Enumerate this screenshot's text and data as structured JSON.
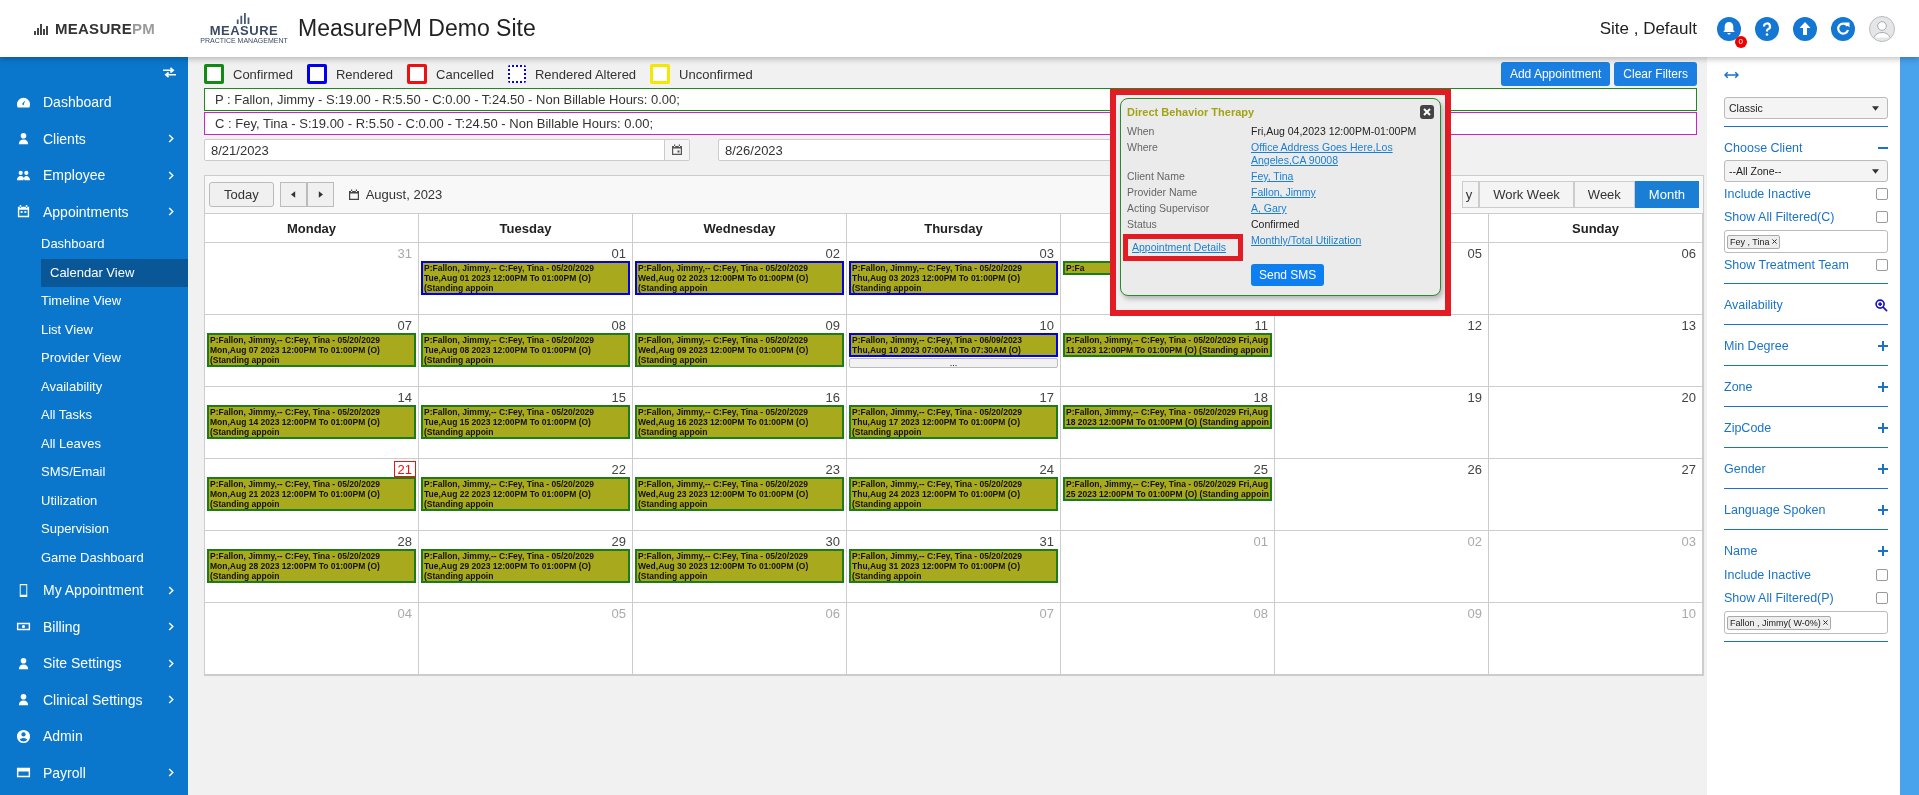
{
  "logo": {
    "main": "MEASURE",
    "accent": "PM"
  },
  "brand": {
    "main": "MEASURE",
    "tagline": "PRACTICE MANAGEMENT"
  },
  "site_title": "MeasurePM Demo Site",
  "user": {
    "site": "Site , Default",
    "notifications": "0"
  },
  "sidebar": {
    "items": [
      {
        "label": "Dashboard",
        "has_submenu": false
      },
      {
        "label": "Clients",
        "has_submenu": true
      },
      {
        "label": "Employee",
        "has_submenu": true
      },
      {
        "label": "Appointments",
        "has_submenu": true,
        "children": [
          {
            "label": "Dashboard",
            "selected": false
          },
          {
            "label": "Calendar View",
            "selected": true
          },
          {
            "label": "Timeline View",
            "selected": false
          },
          {
            "label": "List View",
            "selected": false
          },
          {
            "label": "Provider View",
            "selected": false
          },
          {
            "label": "Availability",
            "selected": false
          },
          {
            "label": "All Tasks",
            "selected": false
          },
          {
            "label": "All Leaves",
            "selected": false
          },
          {
            "label": "SMS/Email",
            "selected": false
          },
          {
            "label": "Utilization",
            "selected": false
          },
          {
            "label": "Supervision",
            "selected": false
          },
          {
            "label": "Game Dashboard",
            "selected": false
          }
        ]
      },
      {
        "label": "My Appointment",
        "has_submenu": true
      },
      {
        "label": "Billing",
        "has_submenu": true
      },
      {
        "label": "Site Settings",
        "has_submenu": true
      },
      {
        "label": "Clinical Settings",
        "has_submenu": true
      },
      {
        "label": "Admin",
        "has_submenu": false
      },
      {
        "label": "Payroll",
        "has_submenu": true
      }
    ]
  },
  "legend": [
    {
      "label": "Confirmed",
      "color": "#138a13",
      "dashed": false
    },
    {
      "label": "Rendered",
      "color": "#0000ee",
      "dashed": false
    },
    {
      "label": "Cancelled",
      "color": "#ee1111",
      "dashed": false
    },
    {
      "label": "Rendered Altered",
      "color": "#0000ee",
      "dashed": true
    },
    {
      "label": "Unconfirmed",
      "color": "#f5e800",
      "dashed": false
    }
  ],
  "actions": [
    "Add Appointment",
    "Clear Filters"
  ],
  "summaries": [
    {
      "text": "P : Fallon, Jimmy - S:19.00 - R:5.50 - C:0.00 - T:24.50 - Non Billable Hours: 0.00;",
      "color": "#1e8a1e"
    },
    {
      "text": "C : Fey, Tina - S:19.00 - R:5.50 - C:0.00 - T:24.50 - Non Billable Hours: 0.00;",
      "color": "#cc22cc"
    }
  ],
  "date_range": {
    "start": "8/21/2023",
    "end": "8/26/2023"
  },
  "calendar": {
    "today_button": "Today",
    "period": "August, 2023",
    "views": [
      {
        "label": "y",
        "selected": false
      },
      {
        "label": "Work Week",
        "selected": false
      },
      {
        "label": "Week",
        "selected": false
      },
      {
        "label": "Month",
        "selected": true
      }
    ],
    "day_headers": [
      "Monday",
      "Tuesday",
      "Wednesday",
      "Thursday",
      "Sunday"
    ],
    "weeks": [
      {
        "days": [
          {
            "day": "31",
            "muted": true,
            "today": false
          },
          {
            "day": "01",
            "muted": false,
            "today": false,
            "events": [
              {
                "color": "#0000ee",
                "text": "P:Fallon, Jimmy,-- C:Fey, Tina - 05/20/2029 Tue,Aug 01 2023 12:00PM To 01:00PM (O) (Standing appoin"
              }
            ]
          },
          {
            "day": "02",
            "muted": false,
            "today": false,
            "events": [
              {
                "color": "#0000ee",
                "text": "P:Fallon, Jimmy,-- C:Fey, Tina - 05/20/2029 Wed,Aug 02 2023 12:00PM To 01:00PM (O) (Standing appoin"
              }
            ]
          },
          {
            "day": "03",
            "muted": false,
            "today": false,
            "events": [
              {
                "color": "#0000ee",
                "text": "P:Fallon, Jimmy,-- C:Fey, Tina - 05/20/2029 Thu,Aug 03 2023 12:00PM To 01:00PM (O) (Standing appoin"
              }
            ]
          },
          {
            "events": [
              {
                "color": "#1a7d1a",
                "text": "P:Fa"
              }
            ]
          },
          {
            "day": "05",
            "muted": false,
            "today": false
          },
          {
            "day": "06",
            "muted": false,
            "today": false
          }
        ]
      },
      {
        "days": [
          {
            "day": "07",
            "muted": false,
            "today": false,
            "events": [
              {
                "color": "#1a7d1a",
                "text": "P:Fallon, Jimmy,-- C:Fey, Tina - 05/20/2029 Mon,Aug 07 2023 12:00PM To 01:00PM (O) (Standing appoin"
              }
            ]
          },
          {
            "day": "08",
            "muted": false,
            "today": false,
            "events": [
              {
                "color": "#1a7d1a",
                "text": "P:Fallon, Jimmy,-- C:Fey, Tina - 05/20/2029 Tue,Aug 08 2023 12:00PM To 01:00PM (O) (Standing appoin"
              }
            ]
          },
          {
            "day": "09",
            "muted": false,
            "today": false,
            "events": [
              {
                "color": "#1a7d1a",
                "text": "P:Fallon, Jimmy,-- C:Fey, Tina - 05/20/2029 Wed,Aug 09 2023 12:00PM To 01:00PM (O) (Standing appoin"
              }
            ]
          },
          {
            "day": "10",
            "muted": false,
            "today": false,
            "events": [
              {
                "color": "#0000ee",
                "text": "P:Fallon, Jimmy,-- C:Fey, Tina - 06/09/2023 Thu,Aug 10 2023 07:00AM To 07:30AM (O)"
              }
            ],
            "more": "..."
          },
          {
            "day": "11",
            "muted": false,
            "today": false,
            "events": [
              {
                "color": "#1a7d1a",
                "text": "P:Fallon, Jimmy,-- C:Fey, Tina - 05/20/2029 Fri,Aug 11 2023 12:00PM To 01:00PM (O) (Standing appoin"
              }
            ]
          },
          {
            "day": "12",
            "muted": false,
            "today": false
          },
          {
            "day": "13",
            "muted": false,
            "today": false
          }
        ]
      },
      {
        "days": [
          {
            "day": "14",
            "muted": false,
            "today": false,
            "events": [
              {
                "color": "#1a7d1a",
                "text": "P:Fallon, Jimmy,-- C:Fey, Tina - 05/20/2029 Mon,Aug 14 2023 12:00PM To 01:00PM (O) (Standing appoin"
              }
            ]
          },
          {
            "day": "15",
            "muted": false,
            "today": false,
            "events": [
              {
                "color": "#1a7d1a",
                "text": "P:Fallon, Jimmy,-- C:Fey, Tina - 05/20/2029 Tue,Aug 15 2023 12:00PM To 01:00PM (O) (Standing appoin"
              }
            ]
          },
          {
            "day": "16",
            "muted": false,
            "today": false,
            "events": [
              {
                "color": "#1a7d1a",
                "text": "P:Fallon, Jimmy,-- C:Fey, Tina - 05/20/2029 Wed,Aug 16 2023 12:00PM To 01:00PM (O) (Standing appoin"
              }
            ]
          },
          {
            "day": "17",
            "muted": false,
            "today": false,
            "events": [
              {
                "color": "#1a7d1a",
                "text": "P:Fallon, Jimmy,-- C:Fey, Tina - 05/20/2029 Thu,Aug 17 2023 12:00PM To 01:00PM (O) (Standing appoin"
              }
            ]
          },
          {
            "day": "18",
            "muted": false,
            "today": false,
            "events": [
              {
                "color": "#1a7d1a",
                "text": "P:Fallon, Jimmy,-- C:Fey, Tina - 05/20/2029 Fri,Aug 18 2023 12:00PM To 01:00PM (O) (Standing appoin"
              }
            ]
          },
          {
            "day": "19",
            "muted": false,
            "today": false
          },
          {
            "day": "20",
            "muted": false,
            "today": false
          }
        ]
      },
      {
        "days": [
          {
            "day": "21",
            "muted": false,
            "today": true,
            "events": [
              {
                "color": "#1a7d1a",
                "text": "P:Fallon, Jimmy,-- C:Fey, Tina - 05/20/2029 Mon,Aug 21 2023 12:00PM To 01:00PM (O) (Standing appoin"
              }
            ]
          },
          {
            "day": "22",
            "muted": false,
            "today": false,
            "events": [
              {
                "color": "#1a7d1a",
                "text": "P:Fallon, Jimmy,-- C:Fey, Tina - 05/20/2029 Tue,Aug 22 2023 12:00PM To 01:00PM (O) (Standing appoin"
              }
            ]
          },
          {
            "day": "23",
            "muted": false,
            "today": false,
            "events": [
              {
                "color": "#1a7d1a",
                "text": "P:Fallon, Jimmy,-- C:Fey, Tina - 05/20/2029 Wed,Aug 23 2023 12:00PM To 01:00PM (O) (Standing appoin"
              }
            ]
          },
          {
            "day": "24",
            "muted": false,
            "today": false,
            "events": [
              {
                "color": "#1a7d1a",
                "text": "P:Fallon, Jimmy,-- C:Fey, Tina - 05/20/2029 Thu,Aug 24 2023 12:00PM To 01:00PM (O) (Standing appoin"
              }
            ]
          },
          {
            "day": "25",
            "muted": false,
            "today": false,
            "events": [
              {
                "color": "#1a7d1a",
                "text": "P:Fallon, Jimmy,-- C:Fey, Tina - 05/20/2029 Fri,Aug 25 2023 12:00PM To 01:00PM (O) (Standing appoin"
              }
            ]
          },
          {
            "day": "26",
            "muted": false,
            "today": false
          },
          {
            "day": "27",
            "muted": false,
            "today": false
          }
        ]
      },
      {
        "days": [
          {
            "day": "28",
            "muted": false,
            "today": false,
            "events": [
              {
                "color": "#1a7d1a",
                "text": "P:Fallon, Jimmy,-- C:Fey, Tina - 05/20/2029 Mon,Aug 28 2023 12:00PM To 01:00PM (O) (Standing appoin"
              }
            ]
          },
          {
            "day": "29",
            "muted": false,
            "today": false,
            "events": [
              {
                "color": "#1a7d1a",
                "text": "P:Fallon, Jimmy,-- C:Fey, Tina - 05/20/2029 Tue,Aug 29 2023 12:00PM To 01:00PM (O) (Standing appoin"
              }
            ]
          },
          {
            "day": "30",
            "muted": false,
            "today": false,
            "events": [
              {
                "color": "#1a7d1a",
                "text": "P:Fallon, Jimmy,-- C:Fey, Tina - 05/20/2029 Wed,Aug 30 2023 12:00PM To 01:00PM (O) (Standing appoin"
              }
            ]
          },
          {
            "day": "31",
            "muted": false,
            "today": false,
            "events": [
              {
                "color": "#1a7d1a",
                "text": "P:Fallon, Jimmy,-- C:Fey, Tina - 05/20/2029 Thu,Aug 31 2023 12:00PM To 01:00PM (O) (Standing appoin"
              }
            ]
          },
          {
            "day": "01",
            "muted": true,
            "today": false
          },
          {
            "day": "02",
            "muted": true,
            "today": false
          },
          {
            "day": "03",
            "muted": true,
            "today": false
          }
        ]
      },
      {
        "days": [
          {
            "day": "04",
            "muted": true,
            "today": false
          },
          {
            "day": "05",
            "muted": true,
            "today": false
          },
          {
            "day": "06",
            "muted": true,
            "today": false
          },
          {
            "day": "07",
            "muted": true,
            "today": false
          },
          {
            "day": "08",
            "muted": true,
            "today": false
          },
          {
            "day": "09",
            "muted": true,
            "today": false
          },
          {
            "day": "10",
            "muted": true,
            "today": false
          }
        ]
      }
    ]
  },
  "popup": {
    "title": "Direct Behavior Therapy",
    "rows": [
      {
        "label": "When",
        "value": "Fri,Aug 04,2023 12:00PM-01:00PM",
        "link": false
      },
      {
        "label": "Where",
        "value": "Office Address Goes Here,Los Angeles,CA 90008",
        "link": true
      },
      {
        "label": "Client Name",
        "value": "Fey, Tina",
        "link": true
      },
      {
        "label": "Provider Name",
        "value": "Fallon, Jimmy",
        "link": true
      },
      {
        "label": "Acting Supervisor",
        "value": "A, Gary",
        "link": true
      },
      {
        "label": "Status",
        "value": "Confirmed",
        "link": false
      }
    ],
    "links": [
      "Appointment Details",
      "Monthly/Total Utilization"
    ],
    "button": "Send SMS"
  },
  "filters": [
    {
      "kind": "select",
      "value": "Classic"
    },
    {
      "kind": "header",
      "label": "Choose Client",
      "expanded": true
    },
    {
      "kind": "select",
      "value": "--All Zone--"
    },
    {
      "kind": "checkbox",
      "label": "Include Inactive",
      "checked": false
    },
    {
      "kind": "checkbox",
      "label": "Show All Filtered(C)",
      "checked": false
    },
    {
      "kind": "tags",
      "tags": [
        "Fey , Tina"
      ]
    },
    {
      "kind": "checkbox",
      "label": "Show Treatment Team",
      "checked": false
    },
    {
      "kind": "search",
      "label": "Availability"
    },
    {
      "kind": "header",
      "label": "Min Degree",
      "expanded": false
    },
    {
      "kind": "header",
      "label": "Zone",
      "expanded": false
    },
    {
      "kind": "header",
      "label": "ZipCode",
      "expanded": false
    },
    {
      "kind": "header",
      "label": "Gender",
      "expanded": false
    },
    {
      "kind": "header",
      "label": "Language Spoken",
      "expanded": false
    },
    {
      "kind": "header",
      "label": "Name",
      "expanded": false
    },
    {
      "kind": "checkbox",
      "label": "Include Inactive",
      "checked": false
    },
    {
      "kind": "checkbox",
      "label": "Show All Filtered(P)",
      "checked": false
    },
    {
      "kind": "tags",
      "tags": [
        "Fallon , Jimmy( W-0%)"
      ]
    }
  ]
}
